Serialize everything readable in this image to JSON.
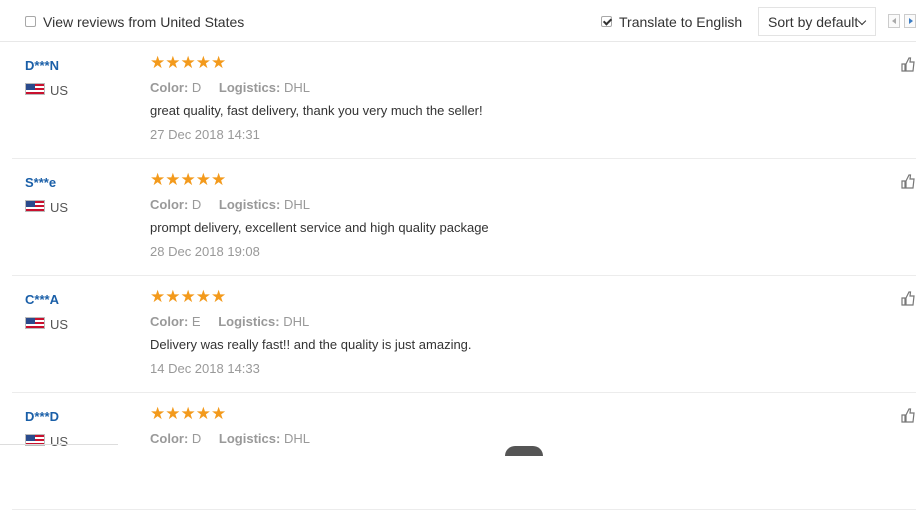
{
  "filters": {
    "us_only_label": "View reviews from United States",
    "us_only_checked": false,
    "translate_label": "Translate to English",
    "translate_checked": true,
    "sort_label": "Sort by default"
  },
  "reviews": [
    {
      "buyer": "D***N",
      "country": "US",
      "stars": "★★★★★",
      "color_label": "Color:",
      "color_value": "D",
      "logistics_label": "Logistics:",
      "logistics_value": "DHL",
      "text": "great quality, fast delivery, thank you very much the seller!",
      "date": "27 Dec 2018 14:31"
    },
    {
      "buyer": "S***e",
      "country": "US",
      "stars": "★★★★★",
      "color_label": "Color:",
      "color_value": "D",
      "logistics_label": "Logistics:",
      "logistics_value": "DHL",
      "text": "prompt delivery, excellent service and high quality package",
      "date": "28 Dec 2018 19:08"
    },
    {
      "buyer": "C***A",
      "country": "US",
      "stars": "★★★★★",
      "color_label": "Color:",
      "color_value": "E",
      "logistics_label": "Logistics:",
      "logistics_value": "DHL",
      "text": "Delivery was really fast!! and the quality is just amazing.",
      "date": "14 Dec 2018 14:33"
    },
    {
      "buyer": "D***D",
      "country": "US",
      "stars": "★★★★★",
      "color_label": "Color:",
      "color_value": "D",
      "logistics_label": "Logistics:",
      "logistics_value": "DHL",
      "text": "",
      "date": ""
    }
  ],
  "icons": {
    "star": "star-icon",
    "flag": "us-flag-icon",
    "like": "thumbs-up-icon",
    "prev": "prev-page-icon",
    "next": "next-page-icon",
    "dropdown": "chevron-down-icon"
  },
  "colors": {
    "buyer_name": "#1a5fa8",
    "stars": "#f39a1c",
    "meta": "#999999",
    "text": "#333333"
  }
}
